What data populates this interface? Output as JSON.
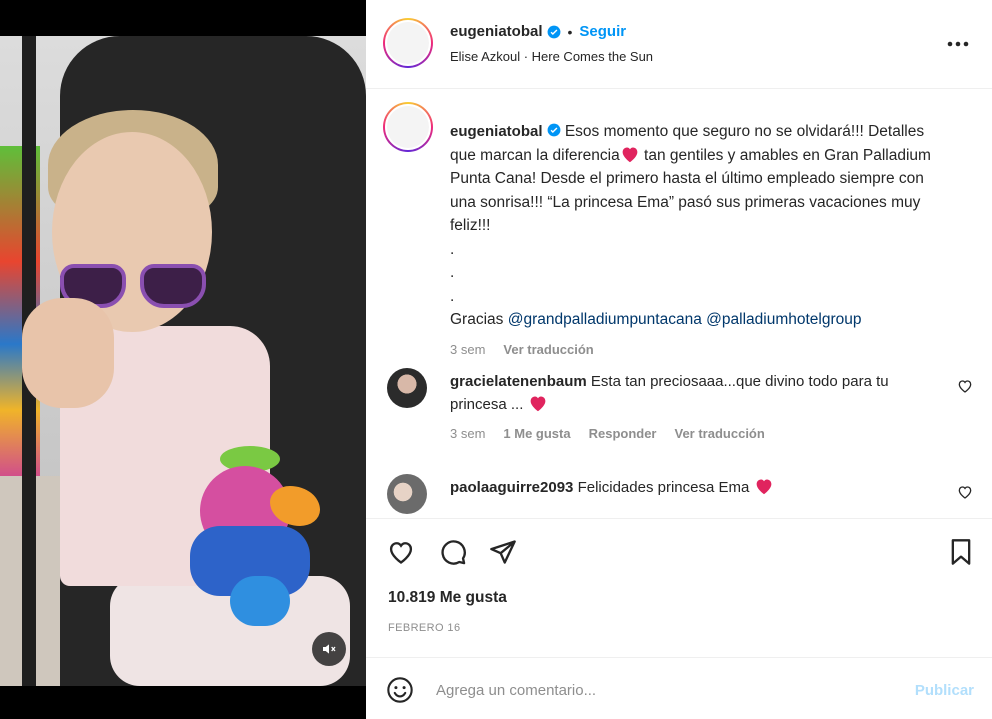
{
  "post": {
    "author": "eugeniatobal",
    "follow_label": "Seguir",
    "dot": "•",
    "audio": "Elise Azkoul · Here Comes the Sun",
    "more_icon": "more-horizontal-icon"
  },
  "caption": {
    "username": "eugeniatobal",
    "text_part1": "Esos momento que seguro no se olvidará!!! Detalles que marcan la diferencia",
    "text_part2": " tan gentiles y amables en Gran Palladium Punta Cana! Desde el primero hasta el último empleado siempre con una sonrisa!!! “La princesa Ema” pasó sus primeras vacaciones muy feliz!!!",
    "dots": [
      ".",
      ".",
      "."
    ],
    "thanks_prefix": "Gracias ",
    "mention1": "@grandpalladiumpuntacana",
    "mention2": "@palladiumhotelgroup",
    "time": "3 sem",
    "translate": "Ver traducción"
  },
  "comments": [
    {
      "username": "gracielatenenbaum",
      "text": "Esta tan preciosaaa...que divino todo para tu princesa ...",
      "time": "3 sem",
      "likes": "1 Me gusta",
      "reply": "Responder",
      "translate": "Ver traducción"
    },
    {
      "username": "paolaaguirre2093",
      "text": "Felicidades princesa Ema"
    }
  ],
  "actions": {
    "likes_count": "10.819 Me gusta",
    "date": "FEBRERO 16"
  },
  "add_comment": {
    "placeholder": "Agrega un comentario...",
    "publish_label": "Publicar"
  },
  "colors": {
    "accent": "#0095f6",
    "heart": "#e0245e",
    "publish_disabled": "#b2dffc",
    "muted_text": "#8e8e8e"
  }
}
